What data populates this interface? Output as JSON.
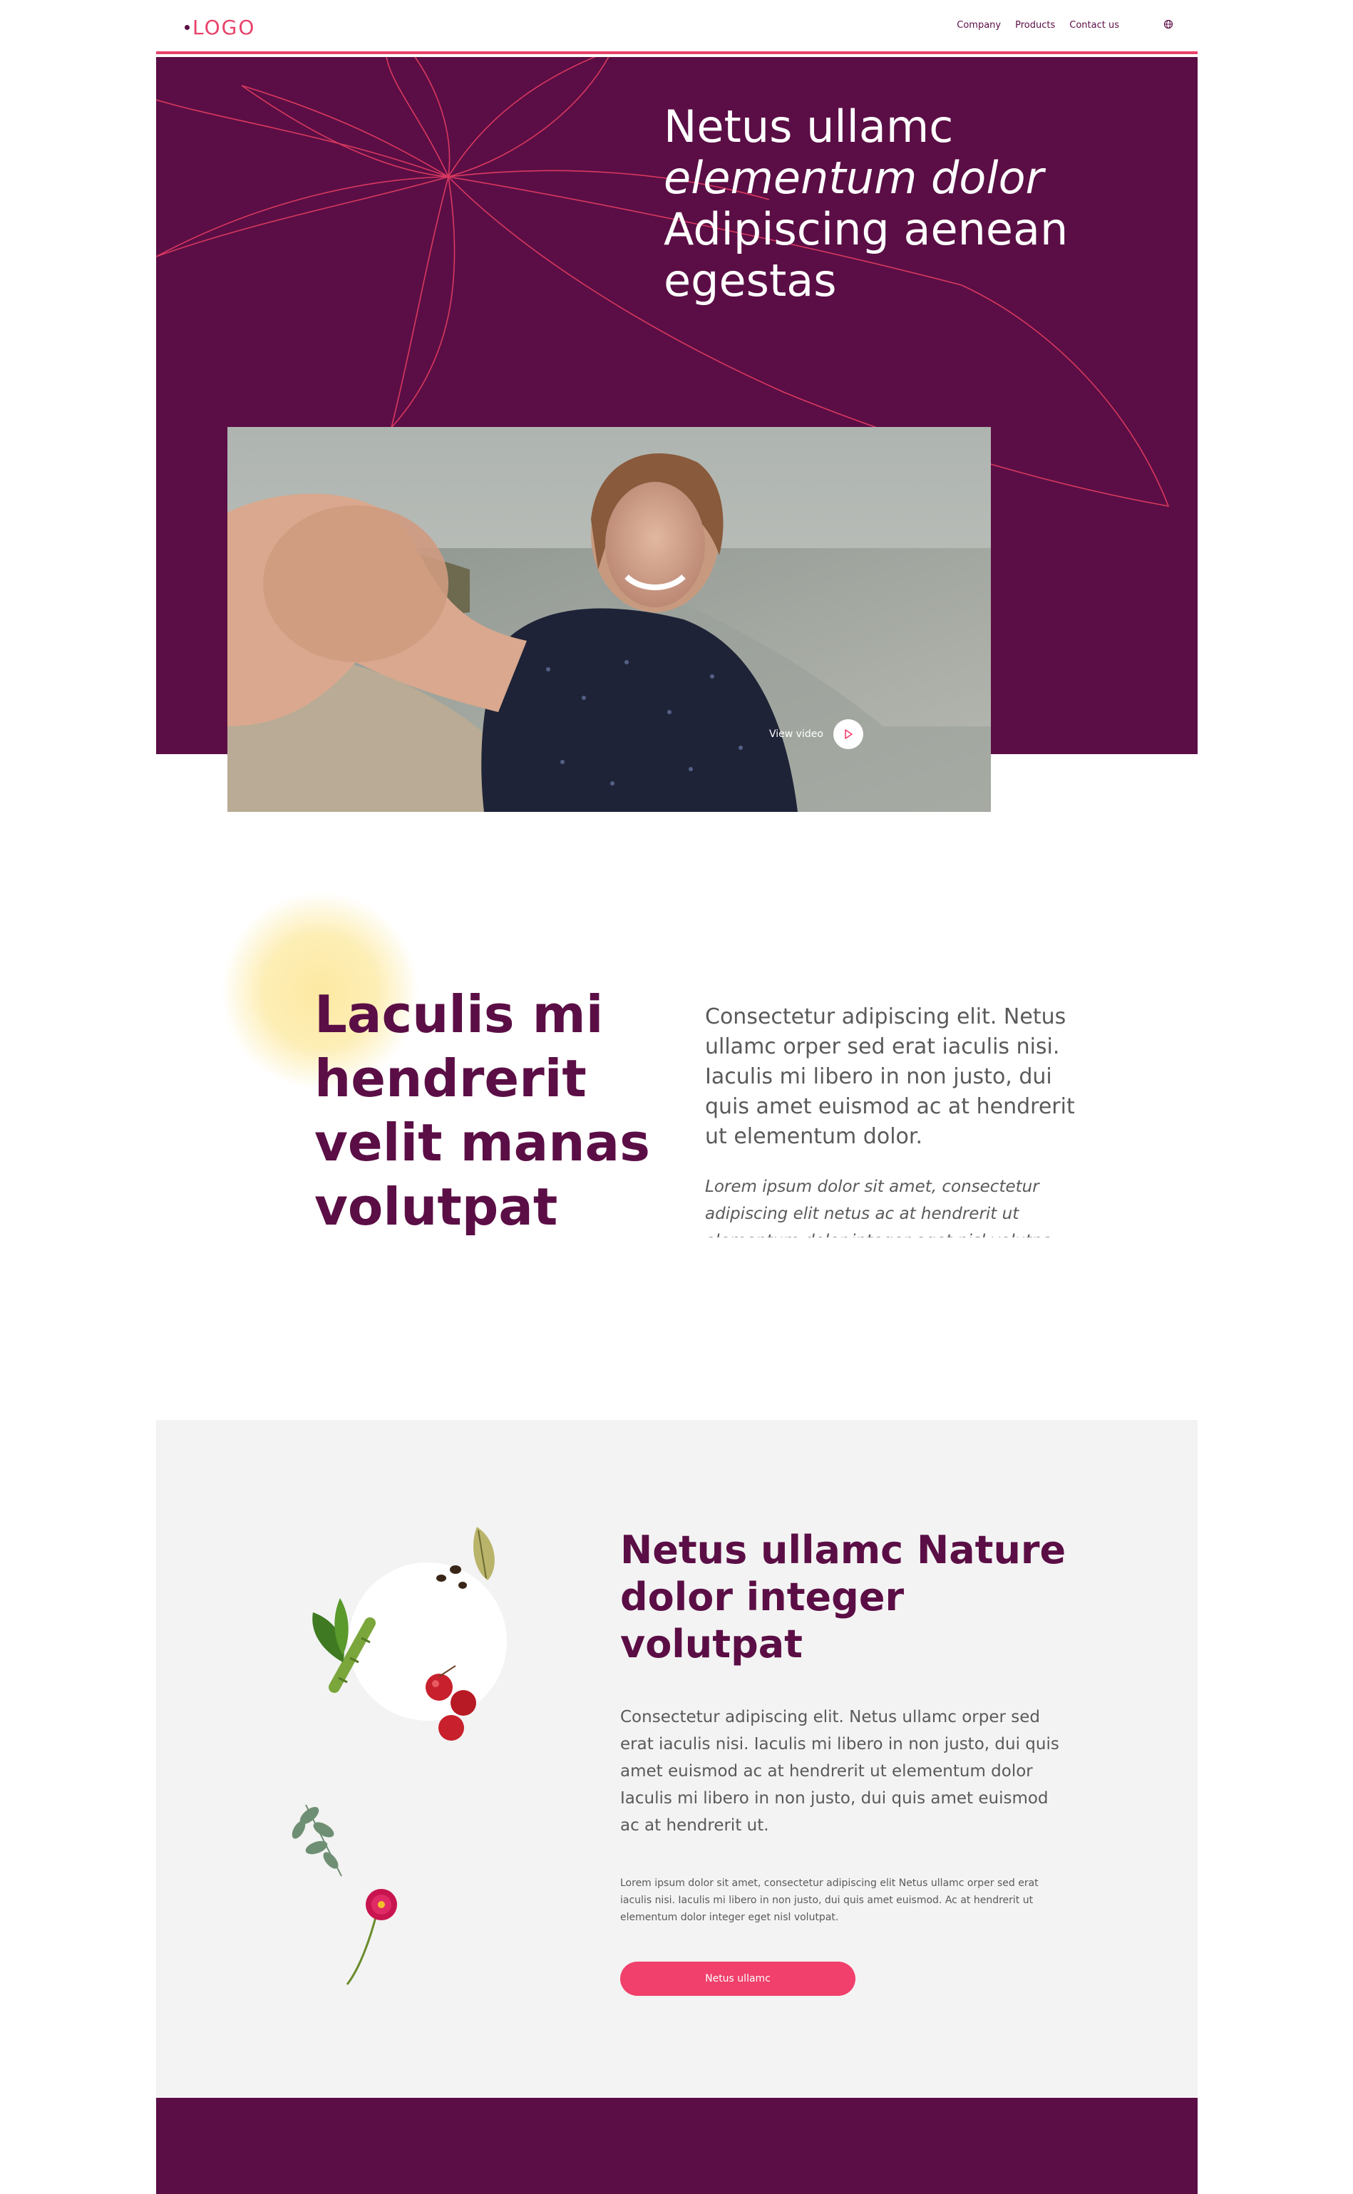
{
  "header": {
    "logo": "LOGO",
    "nav": [
      "Company",
      "Products",
      "Contact us"
    ]
  },
  "hero": {
    "line1": "Netus ullamc",
    "line2": "elementum dolor",
    "line3": "Adipiscing aenean",
    "line4": "egestas",
    "video_label": "View video"
  },
  "intro": {
    "title_l1": "Laculis mi",
    "title_l2": "hendrerit",
    "title_l3": "velit manas",
    "title_l4": "volutpat",
    "body": "Consectetur adipiscing elit. Netus ullamc orper sed erat iaculis nisi. Iaculis mi libero in non justo, dui quis amet euismod ac at hendrerit ut elementum dolor.",
    "small": "Lorem ipsum dolor sit amet, consectetur adipiscing elit netus ac at hendrerit ut elementum dolor integer eget nisl volutpa."
  },
  "nature": {
    "title_l1": "Netus ullamc Nature",
    "title_l2": "dolor integer",
    "title_l3": "volutpat",
    "body": "Consectetur adipiscing elit. Netus ullamc orper sed erat iaculis nisi. Iaculis mi libero in non justo, dui quis amet euismod ac at hendrerit ut elementum dolor Iaculis mi libero in non justo, dui quis amet euismod ac at hendrerit ut.",
    "small": "Lorem ipsum dolor sit amet, consectetur adipiscing elit Netus ullamc orper sed erat iaculis nisi. Iaculis mi libero in non justo, dui quis amet euismod. Ac at hendrerit ut elementum dolor integer eget nisl volutpat.",
    "button": "Netus ullamc"
  },
  "colors": {
    "brand": "#5b0e45",
    "accent": "#f0406b"
  },
  "icons": [
    "globe-icon",
    "play-icon",
    "flower-outline-graphic"
  ]
}
